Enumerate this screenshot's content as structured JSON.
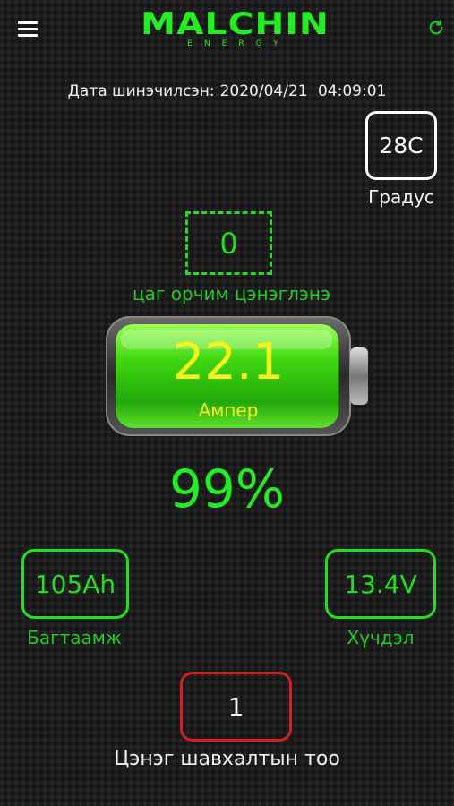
{
  "header": {
    "menu_icon": "hamburger-menu-icon",
    "logo_main": "MALCHIN",
    "logo_sub": "ENERGY",
    "refresh_icon": "refresh-icon",
    "brand_color": "#22ee22"
  },
  "updated": {
    "label": "Дата шинэчилсэн:",
    "date": "2020/04/21",
    "time": "04:09:01"
  },
  "temperature": {
    "value": "28C",
    "label": "Градус"
  },
  "charge_hours": {
    "value": "0",
    "label": "цаг орчим цэнэглэнэ"
  },
  "current": {
    "value": "22.1",
    "label": "Ампер",
    "color": "#f7f21a"
  },
  "state_of_charge": {
    "value": "99%",
    "level": 0.99
  },
  "capacity": {
    "value": "105Ah",
    "label": "Багтаамж"
  },
  "voltage": {
    "value": "13.4V",
    "label": "Хүчдэл"
  },
  "charge_cycles": {
    "value": "1",
    "label": "Цэнэг шавхалтын тоо",
    "border_color": "#d42020"
  }
}
